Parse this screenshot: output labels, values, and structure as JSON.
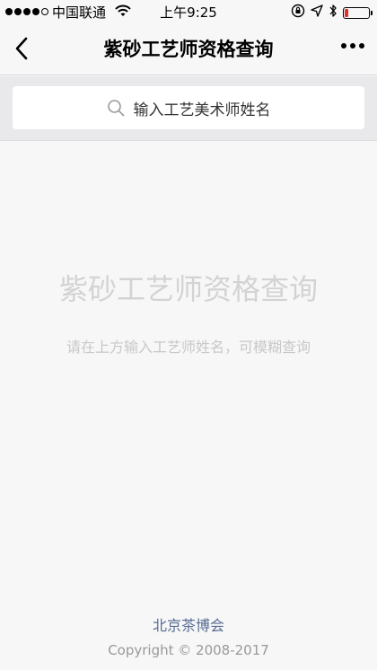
{
  "status_bar": {
    "carrier": "中国联通",
    "time": "上午9:25",
    "signal_bars_filled": 4,
    "signal_bars_total": 5,
    "battery_level_fraction": 0.15,
    "battery_color": "#e0322b"
  },
  "nav": {
    "title": "紫砂工艺师资格查询",
    "back_icon": "chevron-left-icon",
    "more_icon": "more-dots-icon"
  },
  "search": {
    "placeholder": "输入工艺美术师姓名",
    "icon": "search-icon"
  },
  "main": {
    "title": "紫砂工艺师资格查询",
    "hint": "请在上方输入工艺师姓名，可模糊查询"
  },
  "footer": {
    "link": "北京茶博会",
    "copyright": "Copyright © 2008-2017"
  },
  "colors": {
    "background": "#f7f7f7",
    "link": "#586c94"
  }
}
